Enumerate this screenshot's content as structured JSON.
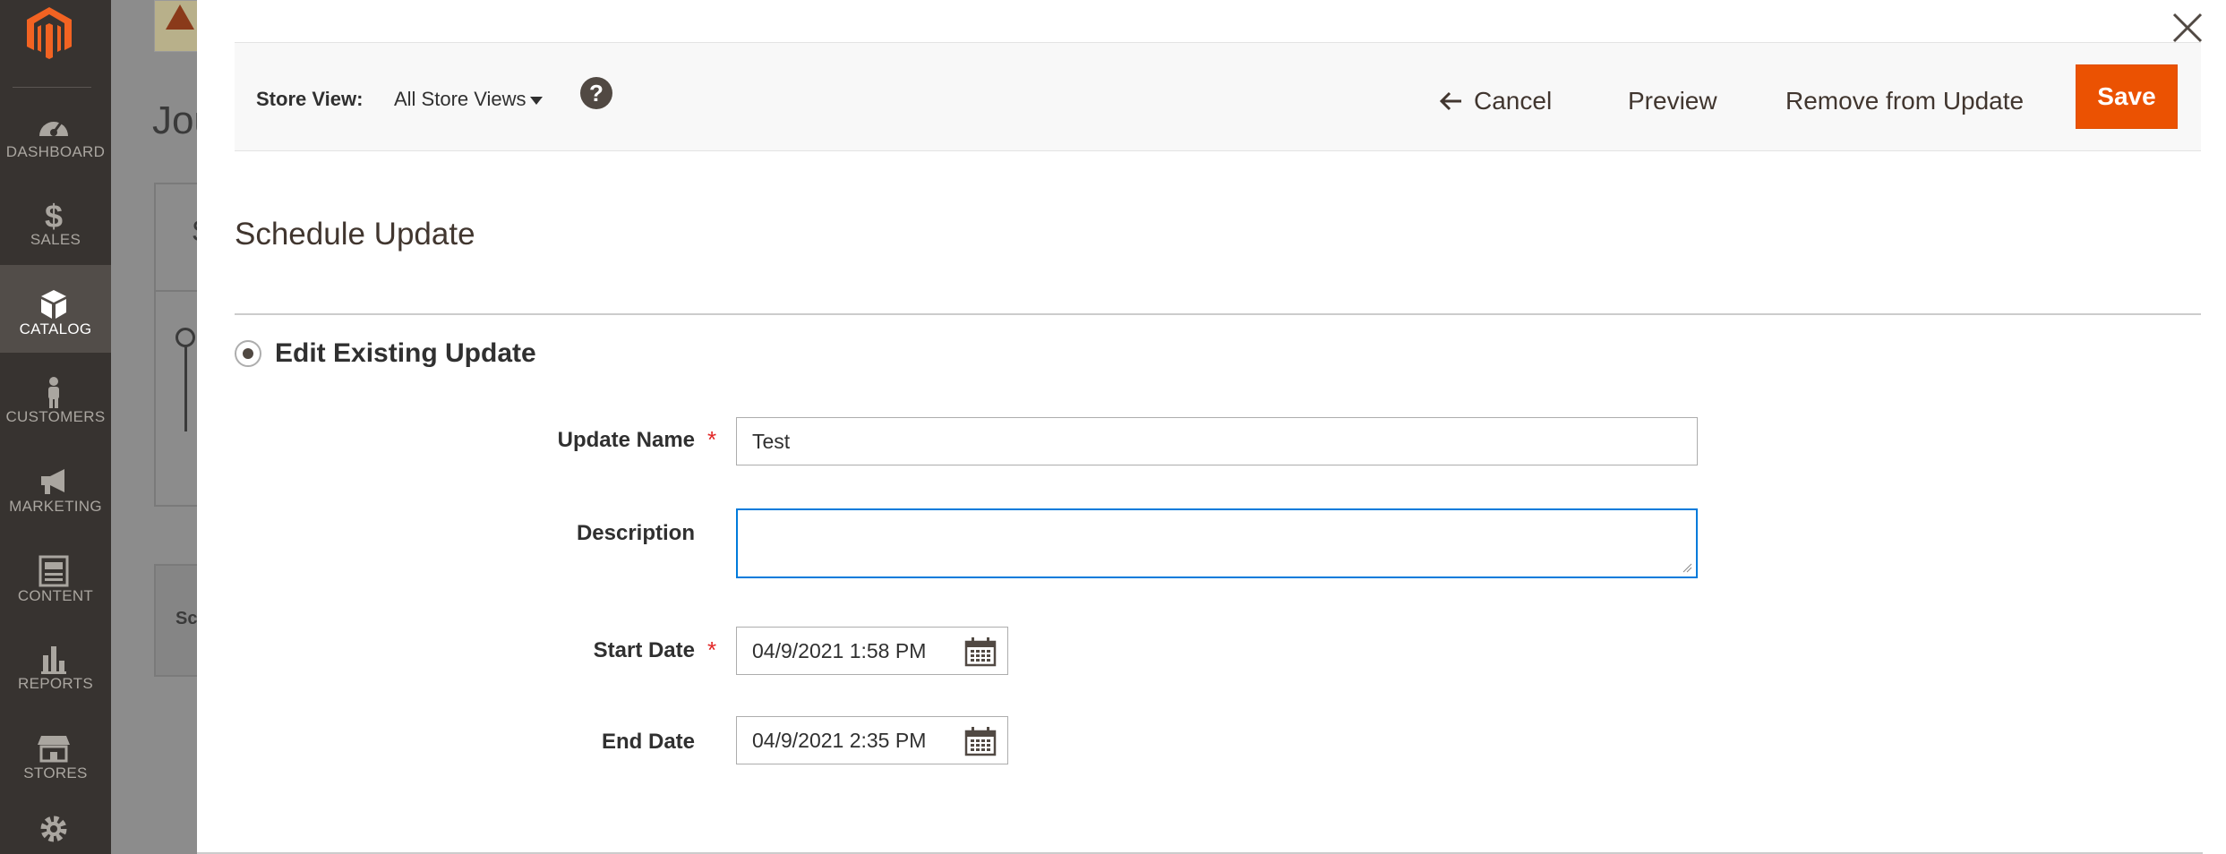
{
  "sidebar": {
    "items": [
      {
        "label": "DASHBOARD",
        "icon": "speedometer-icon"
      },
      {
        "label": "SALES",
        "icon": "dollar-icon"
      },
      {
        "label": "CATALOG",
        "icon": "box-icon",
        "active": true
      },
      {
        "label": "CUSTOMERS",
        "icon": "person-icon"
      },
      {
        "label": "MARKETING",
        "icon": "megaphone-icon"
      },
      {
        "label": "CONTENT",
        "icon": "layout-icon"
      },
      {
        "label": "REPORTS",
        "icon": "bar-chart-icon"
      },
      {
        "label": "STORES",
        "icon": "storefront-icon"
      },
      {
        "label": "",
        "icon": "gear-icon"
      }
    ]
  },
  "background": {
    "title_fragment": "Jou",
    "section_fragment": "Sc",
    "tab_fragment": "S"
  },
  "header": {
    "store_view_label": "Store View:",
    "store_view_value": "All Store Views",
    "help_symbol": "?",
    "cancel_label": "Cancel",
    "preview_label": "Preview",
    "remove_label": "Remove from Update",
    "save_label": "Save"
  },
  "form": {
    "title": "Schedule Update",
    "radio_label": "Edit Existing Update",
    "required_mark": "*",
    "update_name_label": "Update Name",
    "update_name_value": "Test",
    "description_label": "Description",
    "description_value": "",
    "start_date_label": "Start Date",
    "start_date_value": "04/9/2021 1:58 PM",
    "end_date_label": "End Date",
    "end_date_value": "04/9/2021 2:35 PM"
  },
  "colors": {
    "nav_bg": "#373330",
    "nav_active": "#524d49",
    "accent": "#eb5202",
    "focus": "#007bdb",
    "required": "#e22626"
  }
}
